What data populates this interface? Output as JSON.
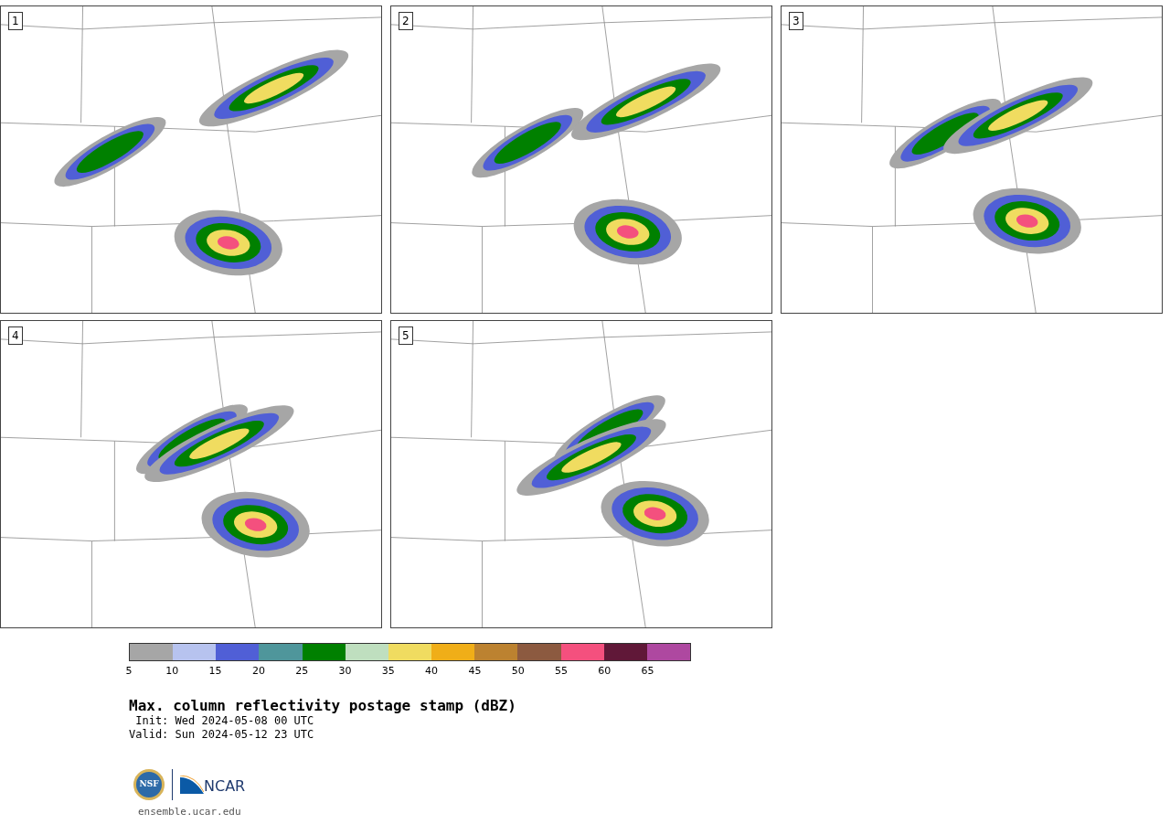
{
  "panels": [
    {
      "label": "1"
    },
    {
      "label": "2"
    },
    {
      "label": "3"
    },
    {
      "label": "4"
    },
    {
      "label": "5"
    }
  ],
  "colorbar": {
    "bins": [
      {
        "color": "#a6a6a6"
      },
      {
        "color": "#b7c3ef"
      },
      {
        "color": "#505fd6"
      },
      {
        "color": "#4f969b"
      },
      {
        "color": "#008000"
      },
      {
        "color": "#bfdfbf"
      },
      {
        "color": "#f0dc60"
      },
      {
        "color": "#f0ae18"
      },
      {
        "color": "#bc8230"
      },
      {
        "color": "#8c5a40"
      },
      {
        "color": "#f4507e"
      },
      {
        "color": "#601838"
      },
      {
        "color": "#ae48a0"
      }
    ],
    "ticks": [
      "5",
      "10",
      "15",
      "20",
      "25",
      "30",
      "35",
      "40",
      "45",
      "50",
      "55",
      "60",
      "65"
    ]
  },
  "title": "Max. column reflectivity postage stamp (dBZ)",
  "init": " Init: Wed 2024-05-08 00 UTC",
  "valid": "Valid: Sun 2024-05-12 23 UTC",
  "logos": {
    "nsf": "NSF",
    "ncar": "NCAR"
  },
  "url": "ensemble.ucar.edu"
}
